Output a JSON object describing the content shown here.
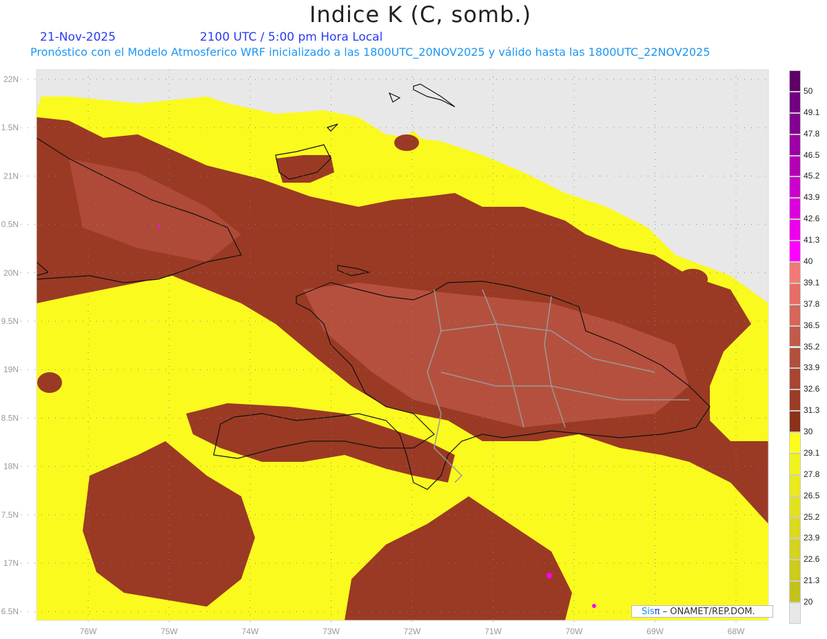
{
  "header": {
    "title": "Indice K (C, somb.)",
    "date": "21-Nov-2025",
    "time": "2100 UTC / 5:00 pm Hora Local",
    "subtitle": "Pronóstico con el Modelo Atmosferico WRF inicializado a las 1800UTC_20NOV2025 y válido hasta las  1800UTC_22NOV2025"
  },
  "axes": {
    "lat_labels": [
      "22N",
      "1.5N",
      "21N",
      "0.5N",
      "20N",
      "9.5N",
      "19N",
      "8.5N",
      "18N",
      "7.5N",
      "17N",
      "6.5N"
    ],
    "lon_labels": [
      "76W",
      "75W",
      "74W",
      "73W",
      "72W",
      "71W",
      "70W",
      "69W",
      "68W"
    ]
  },
  "colorbar": {
    "labels": [
      "20",
      "21.3",
      "22.6",
      "23.9",
      "25.2",
      "26.5",
      "27.8",
      "29.1",
      "30",
      "31.3",
      "32.6",
      "33.9",
      "35.2",
      "36.5",
      "37.8",
      "39.1",
      "40",
      "41.3",
      "42.6",
      "43.9",
      "45.2",
      "46.5",
      "47.8",
      "49.1",
      "50"
    ],
    "colors": [
      "#e8e8e8",
      "#c3c21c",
      "#cccb1e",
      "#d4d31f",
      "#dbda1f",
      "#e2e11f",
      "#eaea1f",
      "#f2f21f",
      "#fcfc1f",
      "#8b3218",
      "#9c3c26",
      "#a84632",
      "#b2503e",
      "#c25a4a",
      "#d66658",
      "#e66e66",
      "#f27a76",
      "#ff00ff",
      "#ec00ec",
      "#dc00dc",
      "#cc00cc",
      "#b400b4",
      "#9c00a4",
      "#840090",
      "#720080",
      "#600068"
    ]
  },
  "credit": {
    "sis": "Sis",
    "pi": "π",
    "text": "– ONAMET/REP.DOM."
  }
}
